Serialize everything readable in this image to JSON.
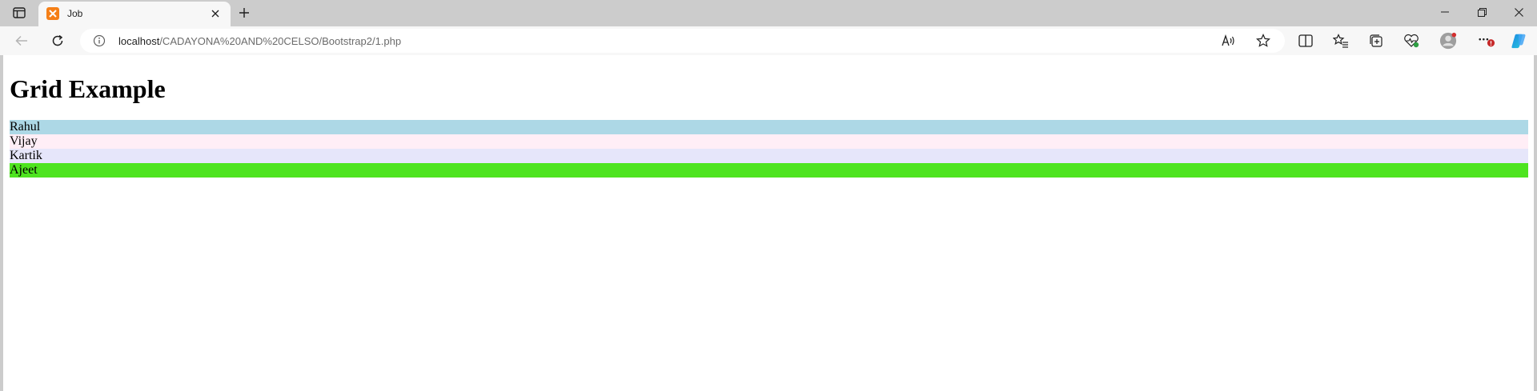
{
  "browser": {
    "tab": {
      "title": "Job"
    },
    "address": {
      "host": "localhost",
      "path": "/CADAYONA%20AND%20CELSO/Bootstrap2/1.php"
    }
  },
  "page": {
    "title": "Grid Example",
    "rows": [
      {
        "label": "Rahul",
        "color": "#add8e6"
      },
      {
        "label": "Vijay",
        "color": "#ffeef6"
      },
      {
        "label": "Kartik",
        "color": "#e6e6fa"
      },
      {
        "label": "Ajeet",
        "color": "#4ee420"
      }
    ]
  }
}
